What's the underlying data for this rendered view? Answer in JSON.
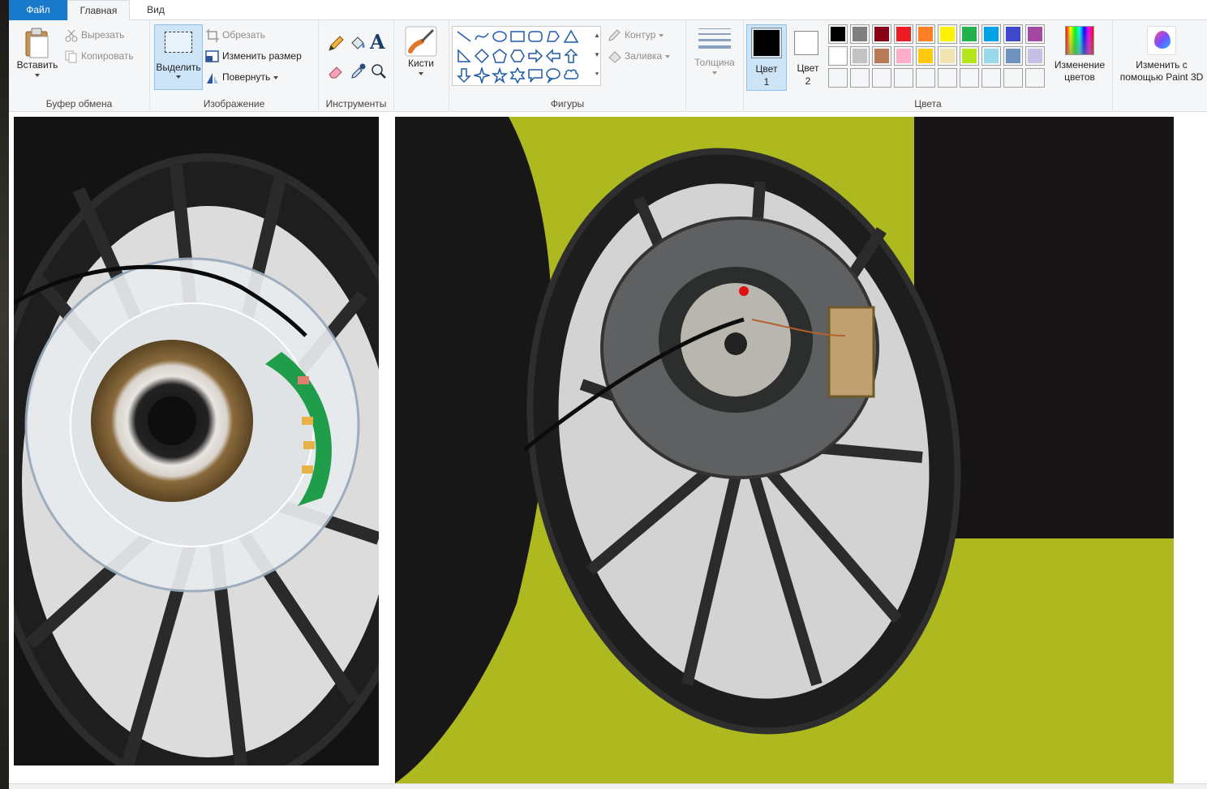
{
  "tabs": {
    "file": "Файл",
    "home": "Главная",
    "view": "Вид"
  },
  "clipboard": {
    "paste": "Вставить",
    "cut": "Вырезать",
    "copy": "Копировать",
    "label": "Буфер обмена"
  },
  "image": {
    "select": "Выделить",
    "crop": "Обрезать",
    "resize": "Изменить размер",
    "rotate": "Повернуть",
    "label": "Изображение"
  },
  "tools": {
    "label": "Инструменты"
  },
  "brushes": {
    "label": "Кисти"
  },
  "shapes": {
    "outline": "Контур",
    "fill": "Заливка",
    "label": "Фигуры"
  },
  "size": {
    "label": "Толщина"
  },
  "colors": {
    "color1_line1": "Цвет",
    "color1_line2": "1",
    "color2_line1": "Цвет",
    "color2_line2": "2",
    "label": "Цвета",
    "edit_line1": "Изменение",
    "edit_line2": "цветов",
    "color1_value": "#000000",
    "color2_value": "#ffffff",
    "palette_row1": [
      "#000000",
      "#7f7f7f",
      "#880015",
      "#ed1c24",
      "#ff7f27",
      "#fff200",
      "#22b14c",
      "#00a2e8",
      "#3f48cc",
      "#a349a4"
    ],
    "palette_row2": [
      "#ffffff",
      "#c3c3c3",
      "#b97a57",
      "#ffaec9",
      "#ffc90e",
      "#efe4b0",
      "#b5e61d",
      "#99d9ea",
      "#7092be",
      "#c8bfe7"
    ],
    "palette_row3": [
      "",
      "",
      "",
      "",
      "",
      "",
      "",
      "",
      "",
      ""
    ]
  },
  "paint3d": {
    "line1": "Изменить с",
    "line2": "помощью Paint 3D"
  }
}
